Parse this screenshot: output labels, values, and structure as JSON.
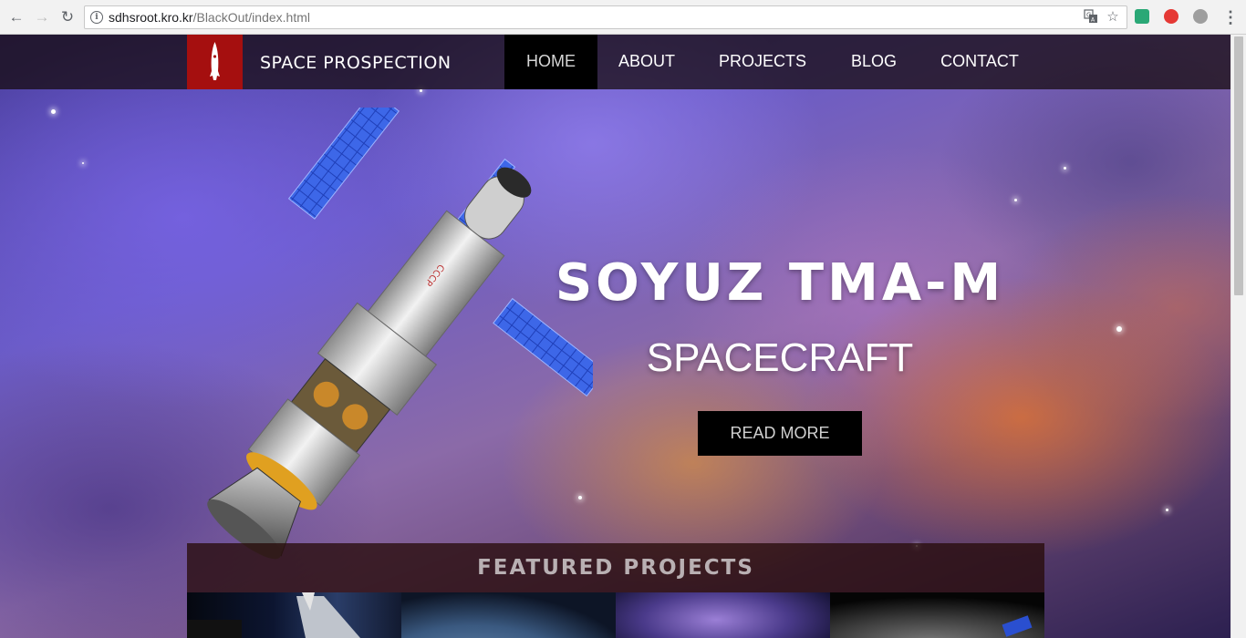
{
  "browser": {
    "url_host": "sdhsroot.kro.kr",
    "url_path": "/BlackOut/index.html"
  },
  "site": {
    "brand": "SPACE PROSPECTION",
    "nav": [
      {
        "label": "HOME",
        "active": true
      },
      {
        "label": "ABOUT",
        "active": false
      },
      {
        "label": "PROJECTS",
        "active": false
      },
      {
        "label": "BLOG",
        "active": false
      },
      {
        "label": "CONTACT",
        "active": false
      }
    ]
  },
  "hero": {
    "title": "SOYUZ TMA-M",
    "subtitle": "SPACECRAFT",
    "button_label": "READ MORE"
  },
  "featured": {
    "title": "FEATURED PROJECTS"
  },
  "colors": {
    "brand_red": "#a50f0f",
    "header_bg": "#14080 8",
    "button_bg": "#000000",
    "panel_blue": "#2a4fd0"
  },
  "icons": [
    "back-arrow-icon",
    "forward-arrow-icon",
    "reload-icon",
    "info-icon",
    "translate-icon",
    "bookmark-star-icon",
    "rocket-logo-icon",
    "menu-dots-icon"
  ]
}
